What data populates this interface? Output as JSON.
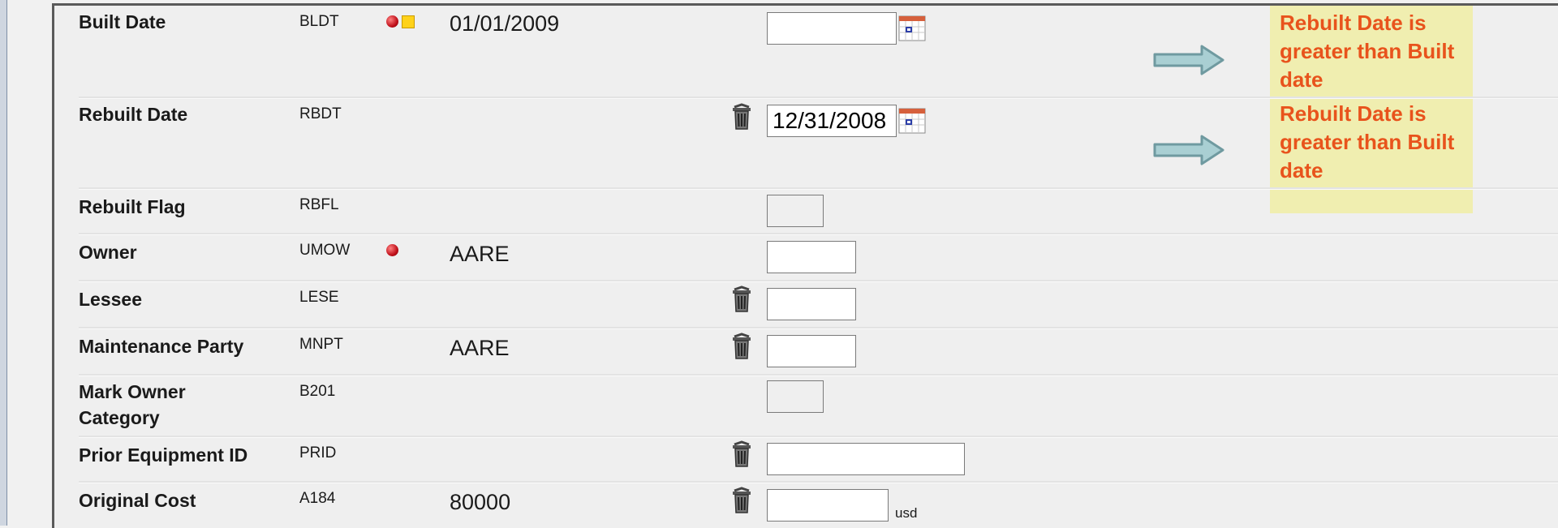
{
  "rows": [
    {
      "label": "Built Date",
      "code": "BLDT",
      "value": "01/01/2009",
      "input_value": ""
    },
    {
      "label": "Rebuilt Date",
      "code": "RBDT",
      "value": "",
      "input_value": "12/31/2008"
    },
    {
      "label": "Rebuilt Flag",
      "code": "RBFL",
      "value": "",
      "input_value": ""
    },
    {
      "label": "Owner",
      "code": "UMOW",
      "value": "AARE",
      "input_value": ""
    },
    {
      "label": "Lessee",
      "code": "LESE",
      "value": "",
      "input_value": ""
    },
    {
      "label": "Maintenance Party",
      "code": "MNPT",
      "value": "AARE",
      "input_value": ""
    },
    {
      "label_line1": "Mark Owner",
      "label_line2": "Category",
      "code": "B201",
      "value": "",
      "input_value": ""
    },
    {
      "label": "Prior Equipment ID",
      "code": "PRID",
      "value": "",
      "input_value": ""
    },
    {
      "label": "Original Cost",
      "code": "A184",
      "value": "80000",
      "input_value": "",
      "unit": "usd"
    }
  ],
  "messages": [
    {
      "line1": "Rebuilt Date is",
      "line2": "greater than Built",
      "line3": "date"
    },
    {
      "line1": "Rebuilt Date is",
      "line2": "greater than Built",
      "line3": "date"
    }
  ],
  "colors": {
    "message_text": "#e8531c",
    "message_bg": "#f0eeb0",
    "arrow_fill": "#a9cfd3",
    "arrow_stroke": "#6f9aa0",
    "required_indicator": "#c0101a",
    "warning_indicator": "#ffd21a"
  },
  "icons": {
    "trash": "trash-icon",
    "calendar": "calendar-icon",
    "required": "required-indicator-icon",
    "warning": "warning-indicator-icon",
    "arrow": "arrow-right-icon"
  }
}
